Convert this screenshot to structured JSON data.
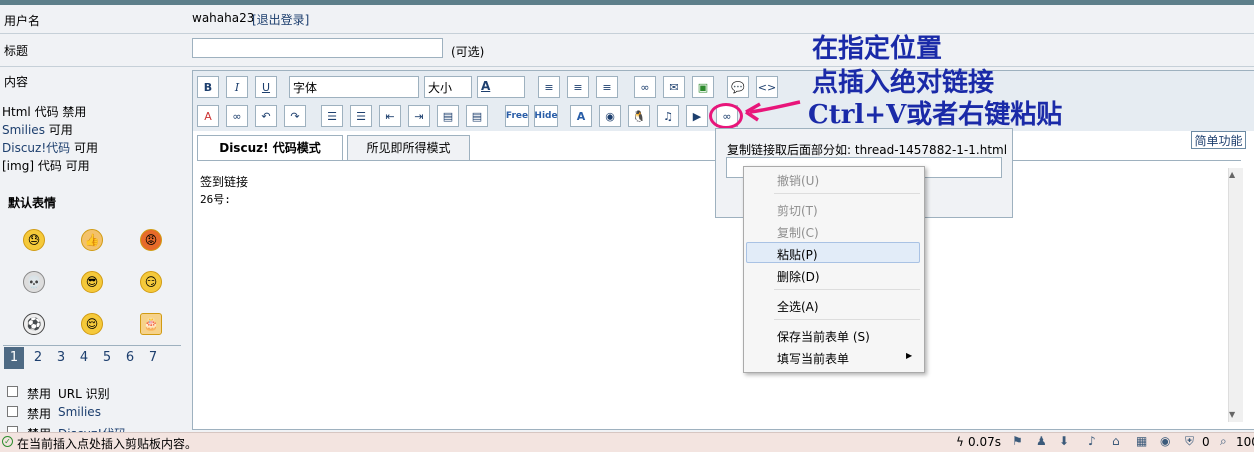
{
  "form": {
    "username_label": "用户名",
    "username_value": "wahaha23",
    "logout_link": "[退出登录]",
    "title_label": "标题",
    "title_optional": "(可选)",
    "content_label": "内容"
  },
  "sidebar": {
    "html_code": "Html 代码",
    "html_status": "禁用",
    "smilies": "Smilies",
    "smilies_status": "可用",
    "discuz_code": "Discuz!代码",
    "discuz_status": "可用",
    "img_code": "[img] 代码",
    "img_status": "可用",
    "emoticons_title": "默认表情",
    "pages": [
      "1",
      "2",
      "3",
      "4",
      "5",
      "6",
      "7"
    ],
    "options": [
      {
        "prefix": "禁用",
        "text": "URL 识别"
      },
      {
        "prefix": "禁用",
        "text": "Smilies"
      },
      {
        "prefix": "禁用",
        "text": "Discuz!代码"
      }
    ]
  },
  "toolbar": {
    "font_select": "字体",
    "size_select": "大小",
    "free_label": "Free",
    "hide_label": "Hide"
  },
  "tabs": {
    "code_mode": "Discuz! 代码模式",
    "wysiwyg_mode": "所见即所得模式"
  },
  "simple_button": "简单功能",
  "editor": {
    "line1": "签到链接",
    "line2": "26号:"
  },
  "link_popup": {
    "label": "复制链接取后面部分如: thread-1457882-1-1.html",
    "input_value": ""
  },
  "context_menu": {
    "undo": "撤销(U)",
    "cut": "剪切(T)",
    "copy": "复制(C)",
    "paste": "粘贴(P)",
    "delete": "删除(D)",
    "select_all": "全选(A)",
    "save_form": "保存当前表单 (S)",
    "fill_form": "填写当前表单"
  },
  "annotation": {
    "line1": "在指定位置",
    "line2": "点插入绝对链接",
    "line3": "Ctrl+V或者右键粘贴"
  },
  "status_bar": {
    "message": "在当前插入点处插入剪贴板内容。",
    "timing": "0.07s",
    "count": "0",
    "zoom": "100"
  },
  "colors": {
    "annotation": "#1a2aa8",
    "highlight_circle": "#e8157a",
    "link": "#1d3f6e"
  }
}
